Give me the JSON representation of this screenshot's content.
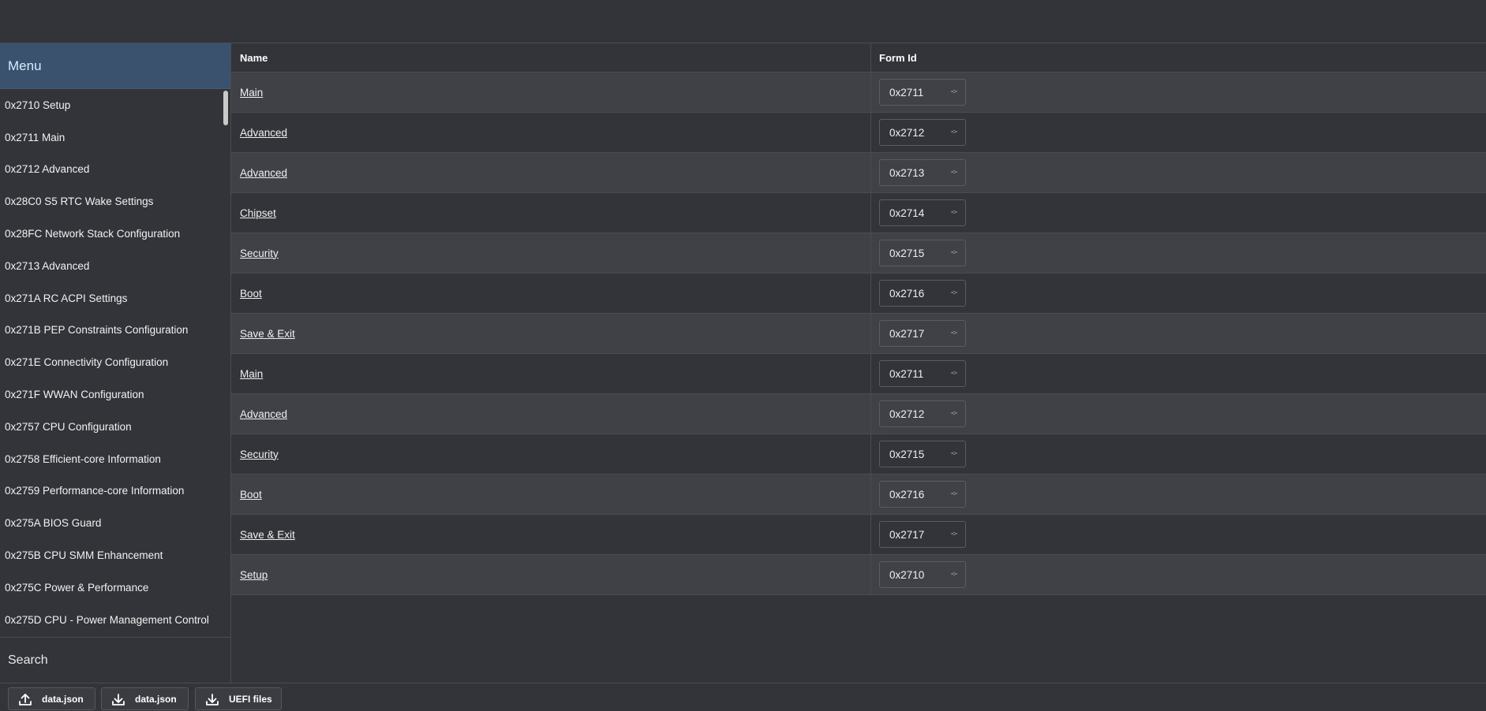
{
  "sidebar": {
    "title": "Menu",
    "items": [
      "0x2710 Setup",
      "0x2711 Main",
      "0x2712 Advanced",
      "0x28C0 S5 RTC Wake Settings",
      "0x28FC Network Stack Configuration",
      "0x2713 Advanced",
      "0x271A RC ACPI Settings",
      "0x271B PEP Constraints Configuration",
      "0x271E Connectivity Configuration",
      "0x271F WWAN Configuration",
      "0x2757 CPU Configuration",
      "0x2758 Efficient-core Information",
      "0x2759 Performance-core Information",
      "0x275A BIOS Guard",
      "0x275B CPU SMM Enhancement",
      "0x275C Power & Performance",
      "0x275D CPU - Power Management Control"
    ],
    "search_label": "Search"
  },
  "table": {
    "columns": {
      "name": "Name",
      "form_id": "Form Id"
    },
    "rows": [
      {
        "name": "Main",
        "form_id": "0x2711"
      },
      {
        "name": "Advanced",
        "form_id": "0x2712"
      },
      {
        "name": "Advanced",
        "form_id": "0x2713"
      },
      {
        "name": "Chipset",
        "form_id": "0x2714"
      },
      {
        "name": "Security",
        "form_id": "0x2715"
      },
      {
        "name": "Boot",
        "form_id": "0x2716"
      },
      {
        "name": "Save & Exit",
        "form_id": "0x2717"
      },
      {
        "name": "Main",
        "form_id": "0x2711"
      },
      {
        "name": "Advanced",
        "form_id": "0x2712"
      },
      {
        "name": "Security",
        "form_id": "0x2715"
      },
      {
        "name": "Boot",
        "form_id": "0x2716"
      },
      {
        "name": "Save & Exit",
        "form_id": "0x2717"
      },
      {
        "name": "Setup",
        "form_id": "0x2710"
      }
    ]
  },
  "bottombar": {
    "buttons": [
      {
        "label": "data.json",
        "icon": "upload-icon"
      },
      {
        "label": "data.json",
        "icon": "download-icon"
      },
      {
        "label": "UEFI files",
        "icon": "download-icon"
      }
    ]
  }
}
